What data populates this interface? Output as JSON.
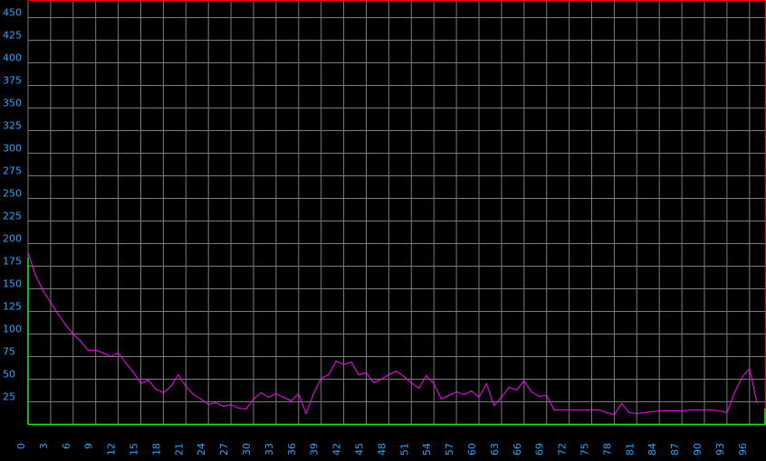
{
  "chart_data": {
    "type": "line",
    "title": "",
    "xlabel": "",
    "ylabel": "",
    "xlim": [
      0,
      98
    ],
    "ylim": [
      0,
      470
    ],
    "grid": true,
    "y_ticks": [
      25,
      50,
      75,
      100,
      125,
      150,
      175,
      200,
      225,
      250,
      275,
      300,
      325,
      350,
      375,
      400,
      425,
      450
    ],
    "x_ticks": [
      0,
      3,
      6,
      9,
      12,
      15,
      18,
      21,
      24,
      27,
      30,
      33,
      36,
      39,
      42,
      45,
      48,
      51,
      54,
      57,
      60,
      63,
      66,
      69,
      72,
      75,
      78,
      81,
      84,
      87,
      90,
      93,
      96
    ],
    "colors": {
      "background": "#000000",
      "grid": "#7a7a7a",
      "line": "#ff00ff",
      "tick_label": "#1fa8ff",
      "top_right_border": "#ff0000",
      "x_axis": "#00ff00",
      "y_axis": "#00ff00"
    },
    "series": [
      {
        "values": [
          [
            0,
            190
          ],
          [
            1,
            165
          ],
          [
            2,
            148
          ],
          [
            3,
            135
          ],
          [
            4,
            122
          ],
          [
            5,
            110
          ],
          [
            6,
            100
          ],
          [
            7,
            92
          ],
          [
            8,
            82
          ],
          [
            9,
            82
          ],
          [
            10,
            79
          ],
          [
            11,
            75
          ],
          [
            12,
            79
          ],
          [
            13,
            68
          ],
          [
            14,
            58
          ],
          [
            15,
            45
          ],
          [
            16,
            49
          ],
          [
            17,
            39
          ],
          [
            18,
            35
          ],
          [
            19,
            42
          ],
          [
            20,
            55
          ],
          [
            21,
            42
          ],
          [
            22,
            33
          ],
          [
            23,
            28
          ],
          [
            24,
            22
          ],
          [
            25,
            24
          ],
          [
            26,
            20
          ],
          [
            27,
            22
          ],
          [
            28,
            18
          ],
          [
            29,
            17
          ],
          [
            30,
            28
          ],
          [
            31,
            35
          ],
          [
            32,
            30
          ],
          [
            33,
            34
          ],
          [
            34,
            30
          ],
          [
            35,
            26
          ],
          [
            36,
            34
          ],
          [
            37,
            12
          ],
          [
            38,
            34
          ],
          [
            39,
            51
          ],
          [
            40,
            55
          ],
          [
            41,
            70
          ],
          [
            42,
            66
          ],
          [
            43,
            69
          ],
          [
            44,
            55
          ],
          [
            45,
            57
          ],
          [
            46,
            46
          ],
          [
            47,
            50
          ],
          [
            48,
            55
          ],
          [
            49,
            59
          ],
          [
            50,
            53
          ],
          [
            51,
            46
          ],
          [
            52,
            40
          ],
          [
            53,
            54
          ],
          [
            54,
            45
          ],
          [
            55,
            28
          ],
          [
            56,
            32
          ],
          [
            57,
            36
          ],
          [
            58,
            33
          ],
          [
            59,
            37
          ],
          [
            60,
            30
          ],
          [
            61,
            45
          ],
          [
            62,
            21
          ],
          [
            63,
            30
          ],
          [
            64,
            41
          ],
          [
            65,
            38
          ],
          [
            66,
            48
          ],
          [
            67,
            36
          ],
          [
            68,
            31
          ],
          [
            69,
            32
          ],
          [
            70,
            16
          ],
          [
            71,
            16
          ],
          [
            72,
            16
          ],
          [
            73,
            16
          ],
          [
            74,
            16
          ],
          [
            75,
            16
          ],
          [
            76,
            16
          ],
          [
            77,
            13
          ],
          [
            78,
            11
          ],
          [
            79,
            23
          ],
          [
            80,
            13
          ],
          [
            81,
            12
          ],
          [
            82,
            13
          ],
          [
            83,
            14
          ],
          [
            84,
            15
          ],
          [
            85,
            15
          ],
          [
            86,
            15
          ],
          [
            87,
            15
          ],
          [
            88,
            16
          ],
          [
            89,
            16
          ],
          [
            90,
            16
          ],
          [
            91,
            16
          ],
          [
            92,
            15
          ],
          [
            93,
            13
          ],
          [
            94,
            35
          ],
          [
            95,
            52
          ],
          [
            96,
            62
          ],
          [
            97,
            24
          ]
        ]
      }
    ]
  }
}
